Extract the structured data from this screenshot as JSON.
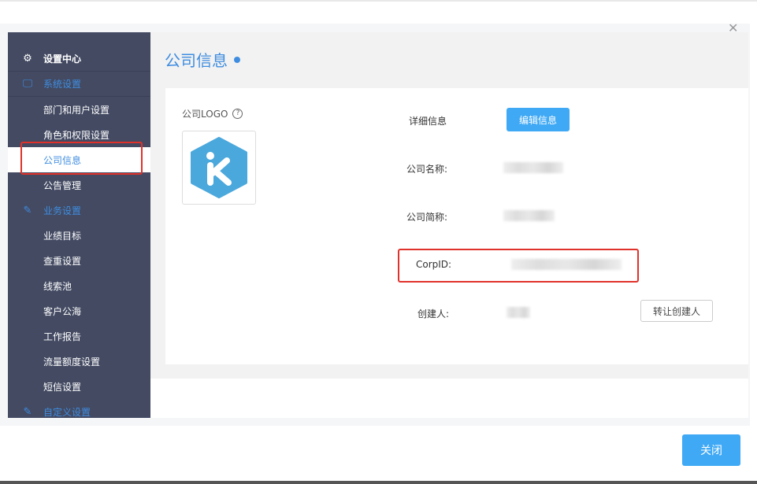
{
  "sidebar": {
    "header": "设置中心",
    "groups": [
      {
        "label": "系统设置",
        "items": [
          "部门和用户设置",
          "角色和权限设置",
          "公司信息",
          "公告管理"
        ]
      },
      {
        "label": "业务设置",
        "items": [
          "业绩目标",
          "查重设置",
          "线索池",
          "客户公海",
          "工作报告",
          "流量额度设置",
          "短信设置"
        ]
      },
      {
        "label": "自定义设置",
        "items": []
      }
    ],
    "active": "公司信息"
  },
  "main": {
    "title": "公司信息",
    "logo_label": "公司LOGO",
    "logo_letter": "K",
    "detail_label": "详细信息",
    "edit_button": "编辑信息",
    "fields": {
      "company_name_label": "公司名称:",
      "short_name_label": "公司简称:",
      "corpid_label": "CorpID:",
      "creator_label": "创建人:"
    },
    "transfer_button": "转让创建人"
  },
  "footer": {
    "close_button": "关闭"
  },
  "colors": {
    "accent": "#3f8de0",
    "button": "#3fa9f5",
    "sidebar": "#434a62",
    "highlight": "#e0322b"
  }
}
